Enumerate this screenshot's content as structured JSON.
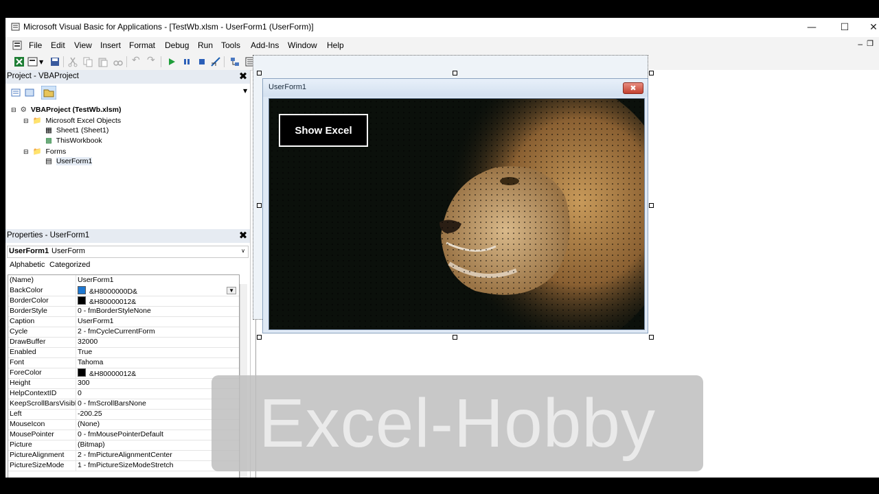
{
  "window": {
    "title": "Microsoft Visual Basic for Applications - [TestWb.xlsm - UserForm1 (UserForm)]"
  },
  "menu": [
    "File",
    "Edit",
    "View",
    "Insert",
    "Format",
    "Debug",
    "Run",
    "Tools",
    "Add-Ins",
    "Window",
    "Help"
  ],
  "project": {
    "title": "Project - VBAProject",
    "tree": [
      {
        "label": "VBAProject (TestWb.xlsm)",
        "level": 0,
        "icon": "vba-project-icon",
        "bold": true
      },
      {
        "label": "Microsoft Excel Objects",
        "level": 1,
        "icon": "folder-icon"
      },
      {
        "label": "Sheet1 (Sheet1)",
        "level": 2,
        "icon": "worksheet-icon"
      },
      {
        "label": "ThisWorkbook",
        "level": 2,
        "icon": "workbook-icon"
      },
      {
        "label": "Forms",
        "level": 1,
        "icon": "folder-icon"
      },
      {
        "label": "UserForm1",
        "level": 2,
        "icon": "userform-icon"
      }
    ]
  },
  "properties": {
    "title": "Properties - UserForm1",
    "object_name": "UserForm1",
    "object_type": "UserForm",
    "tabs": [
      "Alphabetic",
      "Categorized"
    ],
    "rows": [
      {
        "name": "(Name)",
        "value": "UserForm1"
      },
      {
        "name": "BackColor",
        "value": "&H8000000D&",
        "swatch": "#1e78d2",
        "dropdown": true
      },
      {
        "name": "BorderColor",
        "value": "&H80000012&",
        "swatch": "#000000"
      },
      {
        "name": "BorderStyle",
        "value": "0 - fmBorderStyleNone"
      },
      {
        "name": "Caption",
        "value": "UserForm1"
      },
      {
        "name": "Cycle",
        "value": "2 - fmCycleCurrentForm"
      },
      {
        "name": "DrawBuffer",
        "value": "32000"
      },
      {
        "name": "Enabled",
        "value": "True"
      },
      {
        "name": "Font",
        "value": "Tahoma"
      },
      {
        "name": "ForeColor",
        "value": "&H80000012&",
        "swatch": "#000000"
      },
      {
        "name": "Height",
        "value": "300"
      },
      {
        "name": "HelpContextID",
        "value": "0"
      },
      {
        "name": "KeepScrollBarsVisible",
        "value": "0 - fmScrollBarsNone"
      },
      {
        "name": "Left",
        "value": "-200.25"
      },
      {
        "name": "MouseIcon",
        "value": "(None)"
      },
      {
        "name": "MousePointer",
        "value": "0 - fmMousePointerDefault"
      },
      {
        "name": "Picture",
        "value": "(Bitmap)"
      },
      {
        "name": "PictureAlignment",
        "value": "2 - fmPictureAlignmentCenter"
      },
      {
        "name": "PictureSizeMode",
        "value": "1 - fmPictureSizeModeStretch"
      }
    ]
  },
  "userform": {
    "caption": "UserForm1",
    "button_label": "Show Excel"
  },
  "watermark": "Excel-Hobby"
}
